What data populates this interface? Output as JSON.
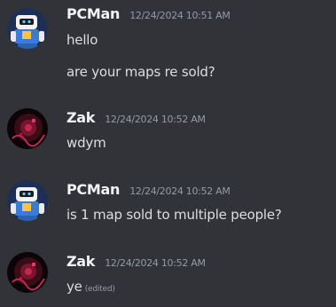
{
  "messages": [
    {
      "author": "PCMan",
      "timestamp": "12/24/2024 10:51 AM",
      "avatar": "robot-avatar-icon",
      "lines": [
        "hello",
        "are your maps re sold?"
      ]
    },
    {
      "author": "Zak",
      "timestamp": "12/24/2024 10:52 AM",
      "avatar": "red-glow-avatar-icon",
      "lines": [
        "wdym"
      ]
    },
    {
      "author": "PCMan",
      "timestamp": "12/24/2024 10:52 AM",
      "avatar": "robot-avatar-icon",
      "lines": [
        "is 1 map sold to multiple people?"
      ]
    },
    {
      "author": "Zak",
      "timestamp": "12/24/2024 10:52 AM",
      "avatar": "red-glow-avatar-icon",
      "lines": [
        "ye"
      ],
      "edited_label": "(edited)"
    }
  ],
  "colors": {
    "background": "#313338",
    "author": "#f2f3f5",
    "timestamp": "#949ba4",
    "text": "#dbdee1"
  }
}
